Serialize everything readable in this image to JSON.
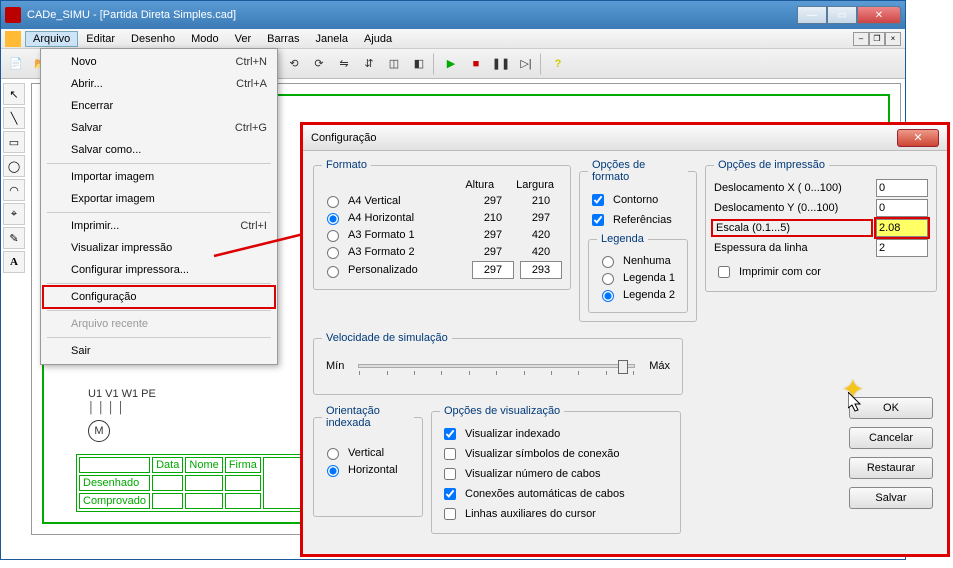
{
  "window": {
    "title": "CADe_SIMU - [Partida Direta Simples.cad]"
  },
  "menubar": [
    "Arquivo",
    "Editar",
    "Desenho",
    "Modo",
    "Ver",
    "Barras",
    "Janela",
    "Ajuda"
  ],
  "dropdown": {
    "items": [
      {
        "label": "Novo",
        "shortcut": "Ctrl+N"
      },
      {
        "label": "Abrir...",
        "shortcut": "Ctrl+A"
      },
      {
        "label": "Encerrar",
        "shortcut": ""
      },
      {
        "label": "Salvar",
        "shortcut": "Ctrl+G"
      },
      {
        "label": "Salvar como...",
        "shortcut": ""
      },
      {
        "sep": true
      },
      {
        "label": "Importar imagem",
        "shortcut": ""
      },
      {
        "label": "Exportar imagem",
        "shortcut": ""
      },
      {
        "sep": true
      },
      {
        "label": "Imprimir...",
        "shortcut": "Ctrl+I"
      },
      {
        "label": "Visualizar impressão",
        "shortcut": ""
      },
      {
        "label": "Configurar impressora...",
        "shortcut": ""
      },
      {
        "sep": true
      },
      {
        "label": "Configuração",
        "shortcut": "",
        "hl": true
      },
      {
        "sep": true
      },
      {
        "label": "Arquivo recente",
        "shortcut": "",
        "disabled": true
      },
      {
        "sep": true
      },
      {
        "label": "Sair",
        "shortcut": ""
      }
    ]
  },
  "dialog": {
    "title": "Configuração",
    "formato": {
      "legend": "Formato",
      "cols": {
        "h": "Altura",
        "w": "Largura"
      },
      "rows": [
        {
          "label": "A4 Vertical",
          "h": "297",
          "w": "210"
        },
        {
          "label": "A4 Horizontal",
          "h": "210",
          "w": "297",
          "checked": true
        },
        {
          "label": "A3 Formato 1",
          "h": "297",
          "w": "420"
        },
        {
          "label": "A3 Formato 2",
          "h": "297",
          "w": "420"
        },
        {
          "label": "Personalizado",
          "h": "297",
          "w": "293",
          "inputs": true
        }
      ]
    },
    "opcoes_formato": {
      "legend": "Opções de formato",
      "contorno": "Contorno",
      "referencias": "Referências",
      "legenda": {
        "legend": "Legenda",
        "opts": [
          "Nenhuma",
          "Legenda 1",
          "Legenda 2"
        ],
        "selected": 2
      }
    },
    "impressao": {
      "legend": "Opções de impressão",
      "desloc_x": {
        "label": "Deslocamento X ( 0...100)",
        "val": "0"
      },
      "desloc_y": {
        "label": "Deslocamento Y (0...100)",
        "val": "0"
      },
      "escala": {
        "label": "Escala (0.1...5)",
        "val": "2.08"
      },
      "espessura": {
        "label": "Espessura da linha",
        "val": "2"
      },
      "cor": "Imprimir com cor"
    },
    "velocidade": {
      "legend": "Velocidade de simulação",
      "min": "Mín",
      "max": "Máx"
    },
    "orientacao": {
      "legend": "Orientação indexada",
      "opts": [
        "Vertical",
        "Horizontal"
      ],
      "selected": 1
    },
    "visual": {
      "legend": "Opções de visualização",
      "items": [
        {
          "label": "Visualizar indexado",
          "checked": true
        },
        {
          "label": "Visualizar símbolos de conexão",
          "checked": false
        },
        {
          "label": "Visualizar número de cabos",
          "checked": false
        },
        {
          "label": "Conexões automáticas de cabos",
          "checked": true
        },
        {
          "label": "Linhas auxiliares do cursor",
          "checked": false
        }
      ]
    },
    "buttons": {
      "ok": "OK",
      "cancel": "Cancelar",
      "restore": "Restaurar",
      "save": "Salvar"
    }
  },
  "titleblock": {
    "r1": [
      "",
      "Data",
      "Nome",
      "Firma"
    ],
    "r2": "Desenhado",
    "r3": "Comprovado"
  },
  "schematic": {
    "labels": "U1 V1 W1 PE",
    "motor": "M",
    "tilde": "~"
  }
}
